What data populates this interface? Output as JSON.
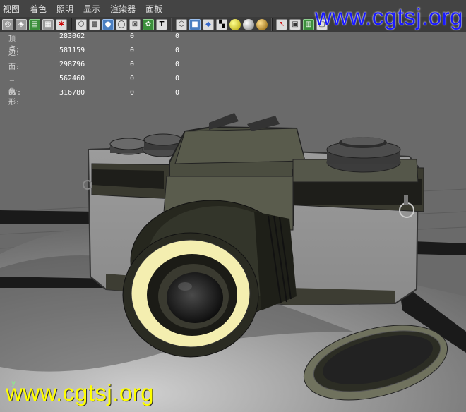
{
  "menu": [
    "视图",
    "着色",
    "照明",
    "显示",
    "渲染器",
    "面板"
  ],
  "watermark": {
    "top": "www.cgtsj.org",
    "bottom": "www.cgtsj.org"
  },
  "hud": {
    "rows": [
      {
        "label": "顶点:",
        "total": "283062",
        "selected": "0",
        "extra": "0"
      },
      {
        "label": "边:",
        "total": "581159",
        "selected": "0",
        "extra": "0"
      },
      {
        "label": "面:",
        "total": "298796",
        "selected": "0",
        "extra": "0"
      },
      {
        "label": "三角形:",
        "total": "562460",
        "selected": "0",
        "extra": "0"
      },
      {
        "label": "UV:",
        "total": "316780",
        "selected": "0",
        "extra": "0"
      }
    ]
  },
  "axis_label": "y",
  "toolbar_icons": [
    "camera-attributes-icon",
    "bookmark-icon",
    "image-plane-icon",
    "grid-icon",
    "select-camera-icon",
    "sep",
    "wireframe-icon",
    "smooth-shade-icon",
    "shaded-wire-icon",
    "bounding-box-icon",
    "xray-icon",
    "texture-icon",
    "text-t-icon",
    "sep",
    "cube-wire-icon",
    "cube-shaded-icon",
    "cube-textured-icon",
    "checker-icon",
    "default-light-icon",
    "all-lights-icon",
    "gold-sphere-icon",
    "sep",
    "select-mask-icon",
    "isolate-icon",
    "show-layers-icon",
    "render-icon"
  ]
}
